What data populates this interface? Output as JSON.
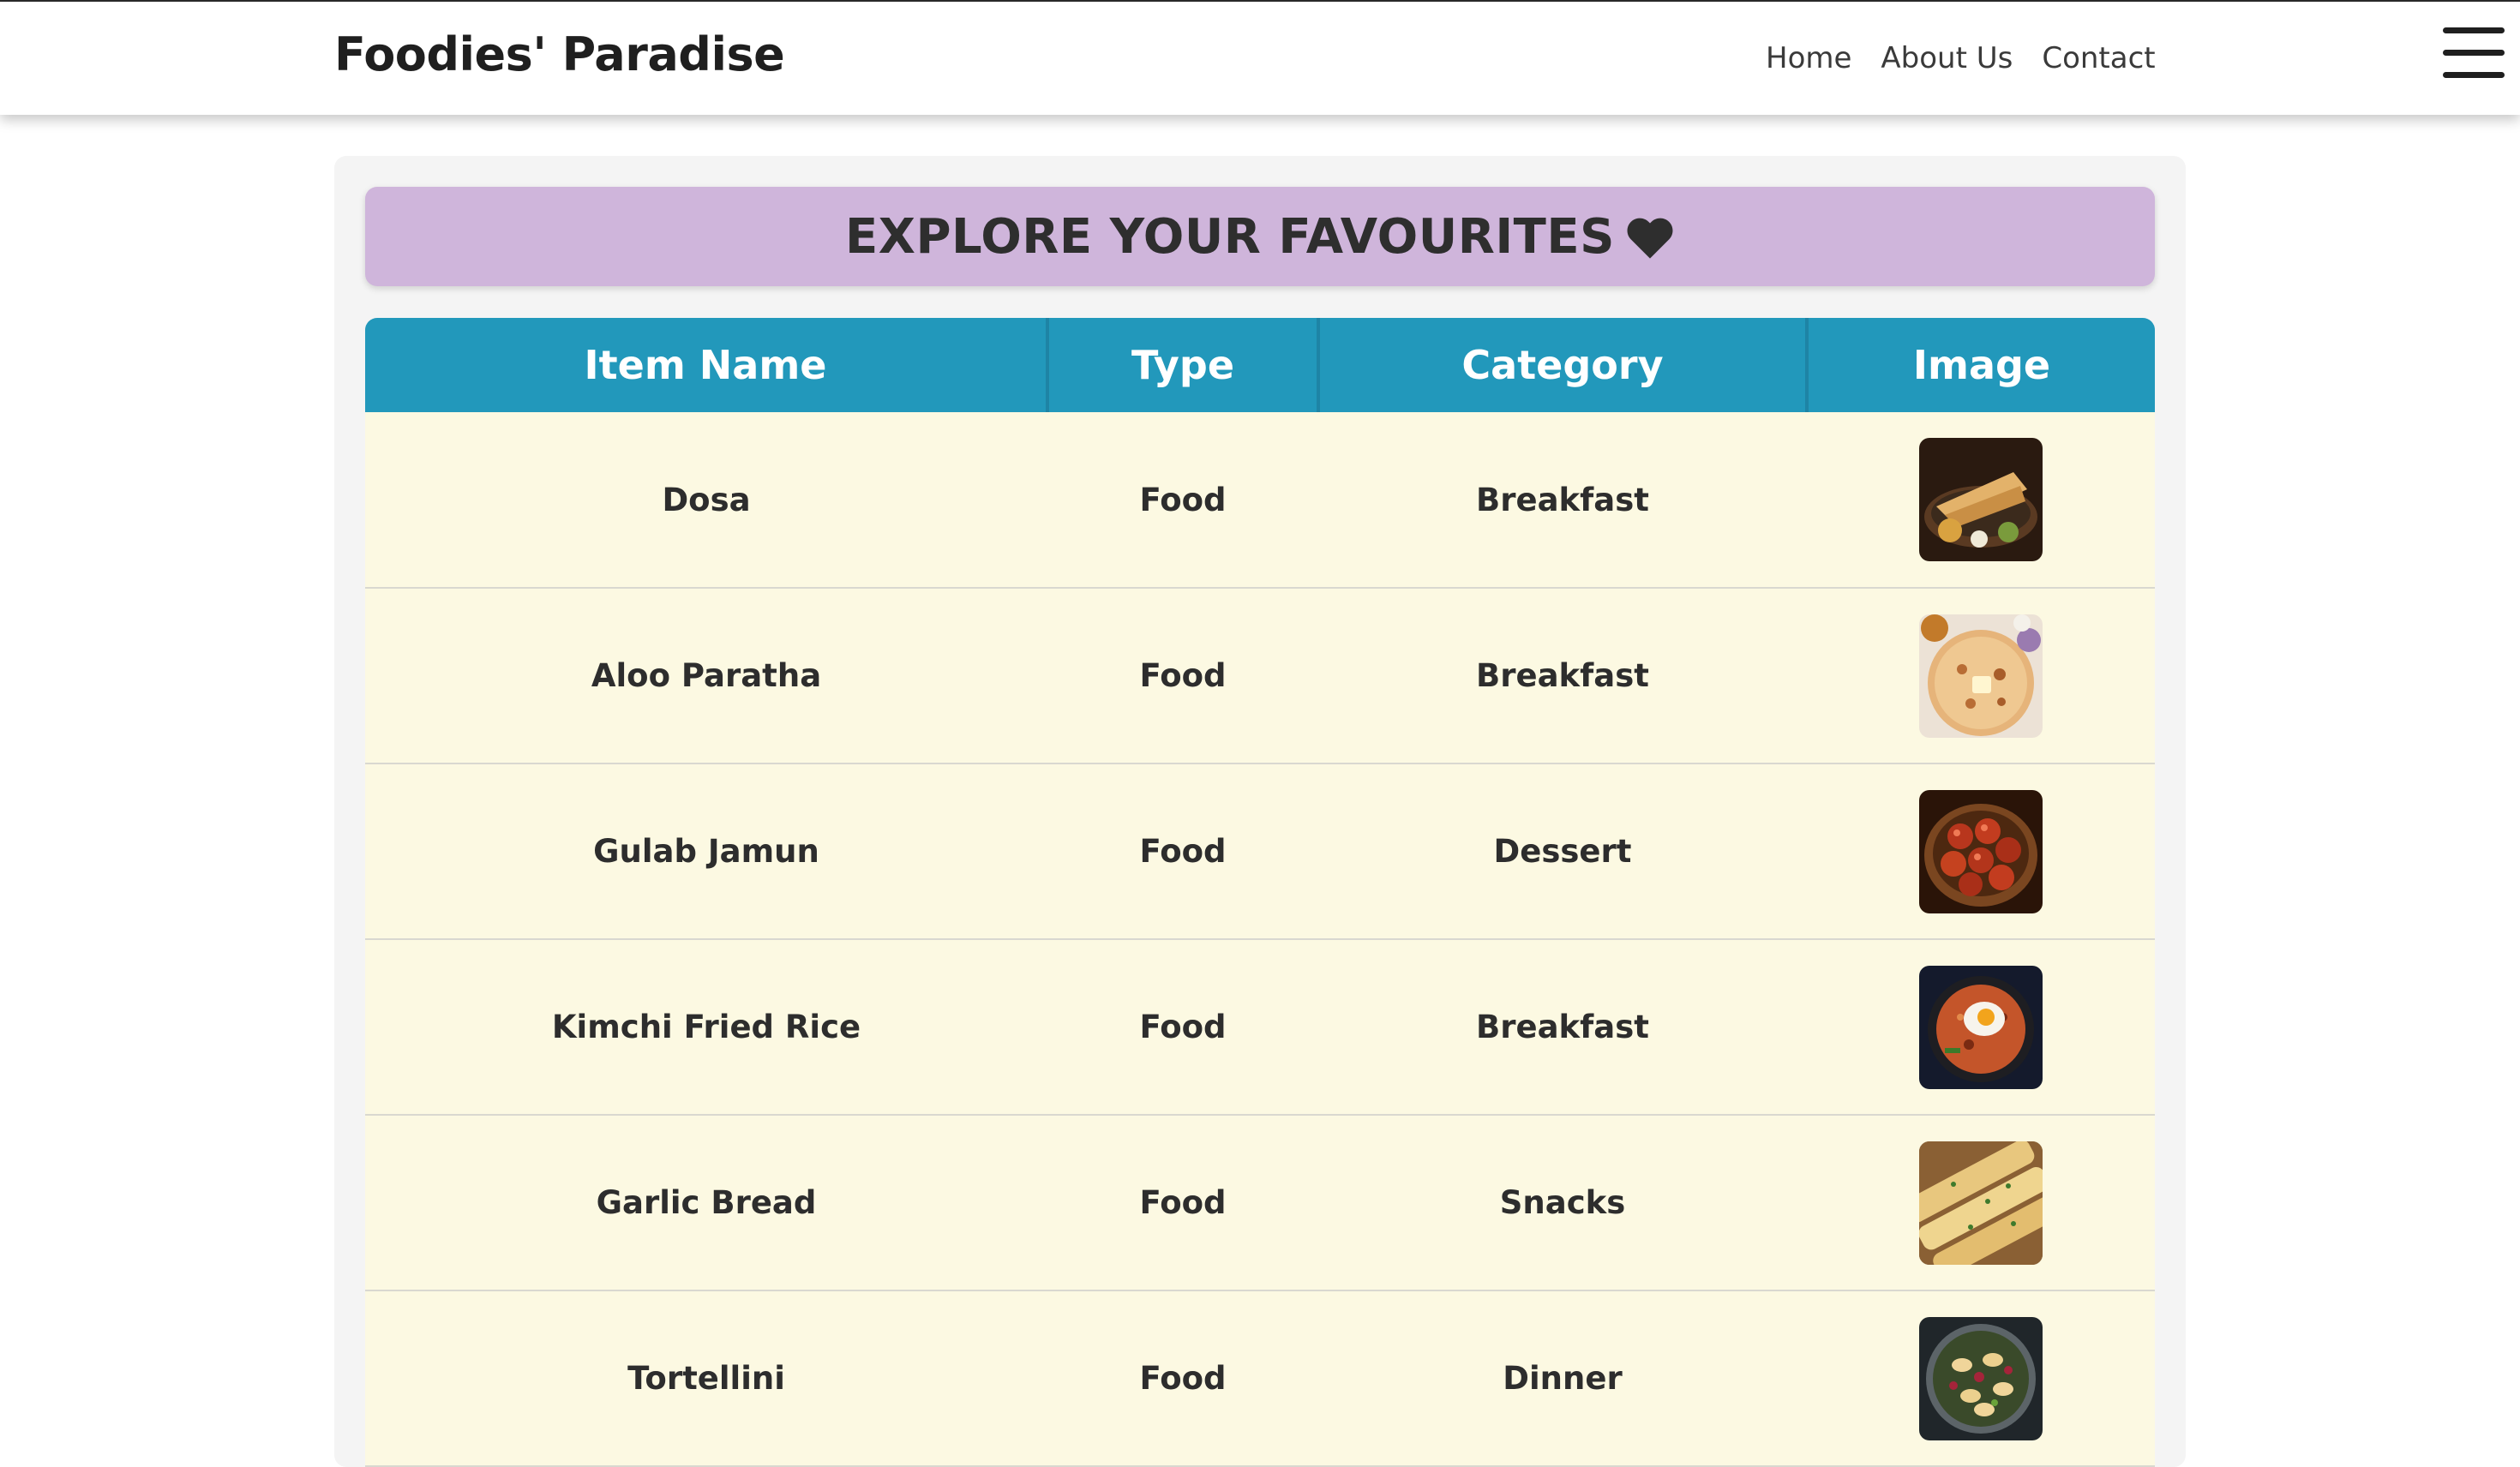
{
  "header": {
    "brand": "Foodies' Paradise",
    "nav": [
      {
        "label": "Home"
      },
      {
        "label": "About Us"
      },
      {
        "label": "Contact"
      }
    ],
    "menu_icon": "hamburger-menu-icon"
  },
  "banner": {
    "title": "EXPLORE YOUR FAVOURITES",
    "icon": "heart-icon",
    "color": "#cfb5db"
  },
  "table": {
    "header_color": "#2298bb",
    "row_color": "#fcf9e2",
    "columns": [
      "Item Name",
      "Type",
      "Category",
      "Image"
    ],
    "rows": [
      {
        "name": "Dosa",
        "type": "Food",
        "category": "Breakfast",
        "image": "dosa-image"
      },
      {
        "name": "Aloo Paratha",
        "type": "Food",
        "category": "Breakfast",
        "image": "aloo-paratha-image"
      },
      {
        "name": "Gulab Jamun",
        "type": "Food",
        "category": "Dessert",
        "image": "gulab-jamun-image"
      },
      {
        "name": "Kimchi Fried Rice",
        "type": "Food",
        "category": "Breakfast",
        "image": "kimchi-fried-rice-image"
      },
      {
        "name": "Garlic Bread",
        "type": "Food",
        "category": "Snacks",
        "image": "garlic-bread-image"
      },
      {
        "name": "Tortellini",
        "type": "Food",
        "category": "Dinner",
        "image": "tortellini-image"
      }
    ]
  }
}
